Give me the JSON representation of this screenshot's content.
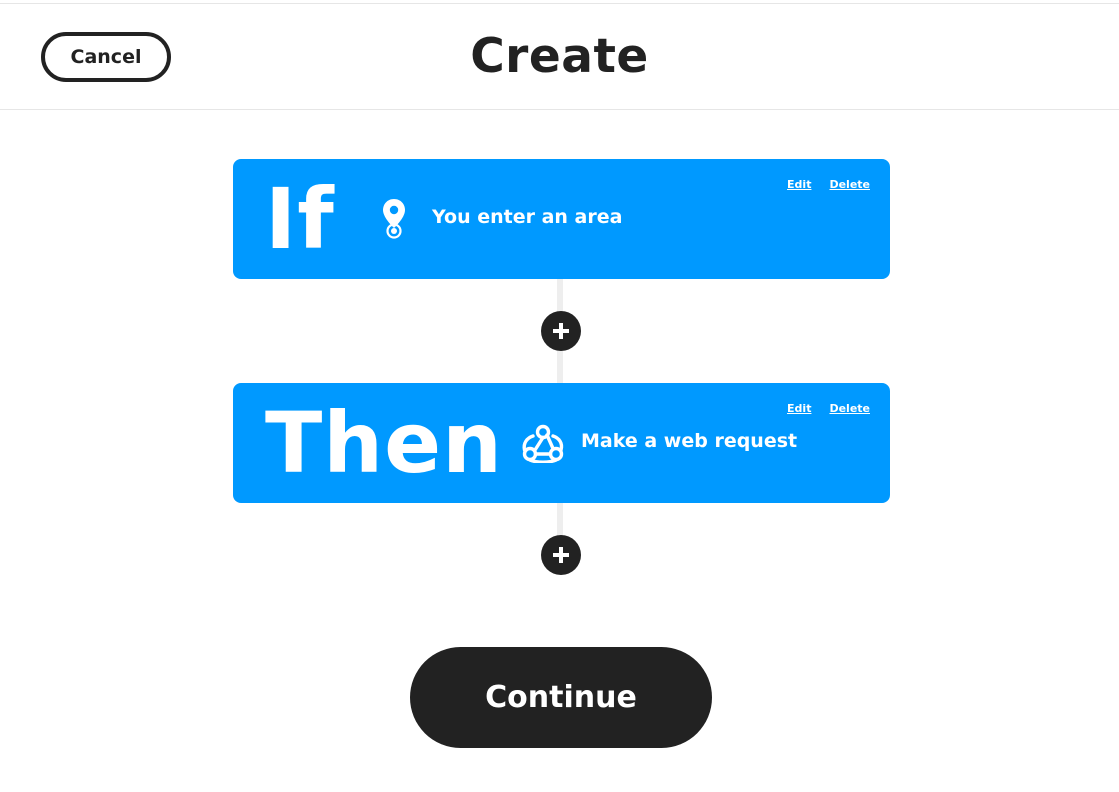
{
  "header": {
    "cancel_label": "Cancel",
    "title": "Create"
  },
  "trigger": {
    "keyword": "If",
    "icon": "location-pin-icon",
    "label": "You enter an area",
    "edit_label": "Edit",
    "delete_label": "Delete"
  },
  "action": {
    "keyword": "Then",
    "icon": "webhook-icon",
    "label": "Make a web request",
    "edit_label": "Edit",
    "delete_label": "Delete"
  },
  "add_buttons": [
    {
      "icon": "plus-icon"
    },
    {
      "icon": "plus-icon"
    }
  ],
  "continue_label": "Continue",
  "colors": {
    "card_blue": "#0099ff",
    "dark": "#222222",
    "divider": "#e6e6e6"
  }
}
